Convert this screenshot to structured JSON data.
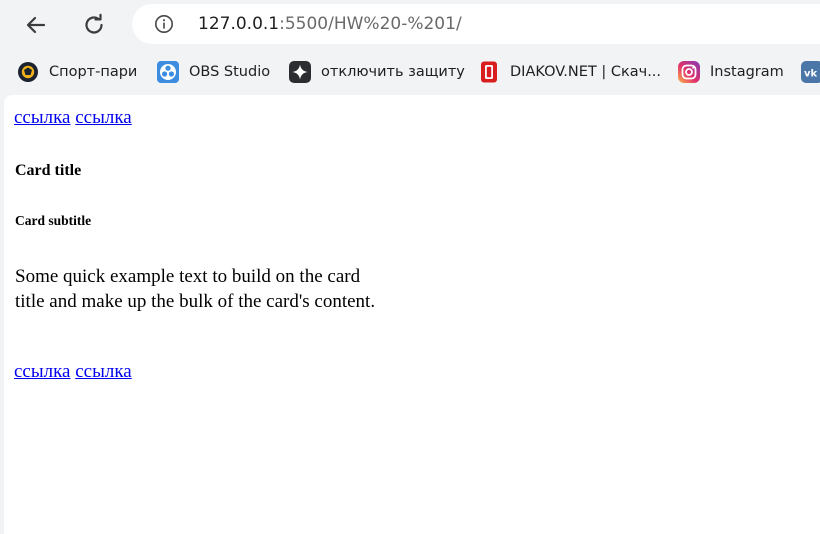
{
  "browser": {
    "url_host": "127.0.0.1",
    "url_path": ":5500/HW%20-%201/"
  },
  "bookmarks": [
    {
      "label": "Спорт-пари",
      "icon": "sport-pari-icon"
    },
    {
      "label": "OBS Studio",
      "icon": "obs-studio-icon"
    },
    {
      "label": "отключить защиту",
      "icon": "sparkle-icon"
    },
    {
      "label": "DIAKOV.NET | Скач...",
      "icon": "diakov-icon"
    },
    {
      "label": "Instagram",
      "icon": "instagram-icon"
    },
    {
      "label": "",
      "icon": "vk-icon"
    }
  ],
  "page": {
    "top_links": [
      "ссылка",
      "ссылка"
    ],
    "card_title": "Card title",
    "card_subtitle": "Card subtitle",
    "card_text": "Some quick example text to build on the card title and make up the bulk of the card's content.",
    "bottom_links": [
      "ссылка",
      "ссылка"
    ]
  },
  "colors": {
    "link": "#0000ee",
    "toolbar_bg": "#f1f3f4",
    "page_bg": "#ffffff"
  }
}
